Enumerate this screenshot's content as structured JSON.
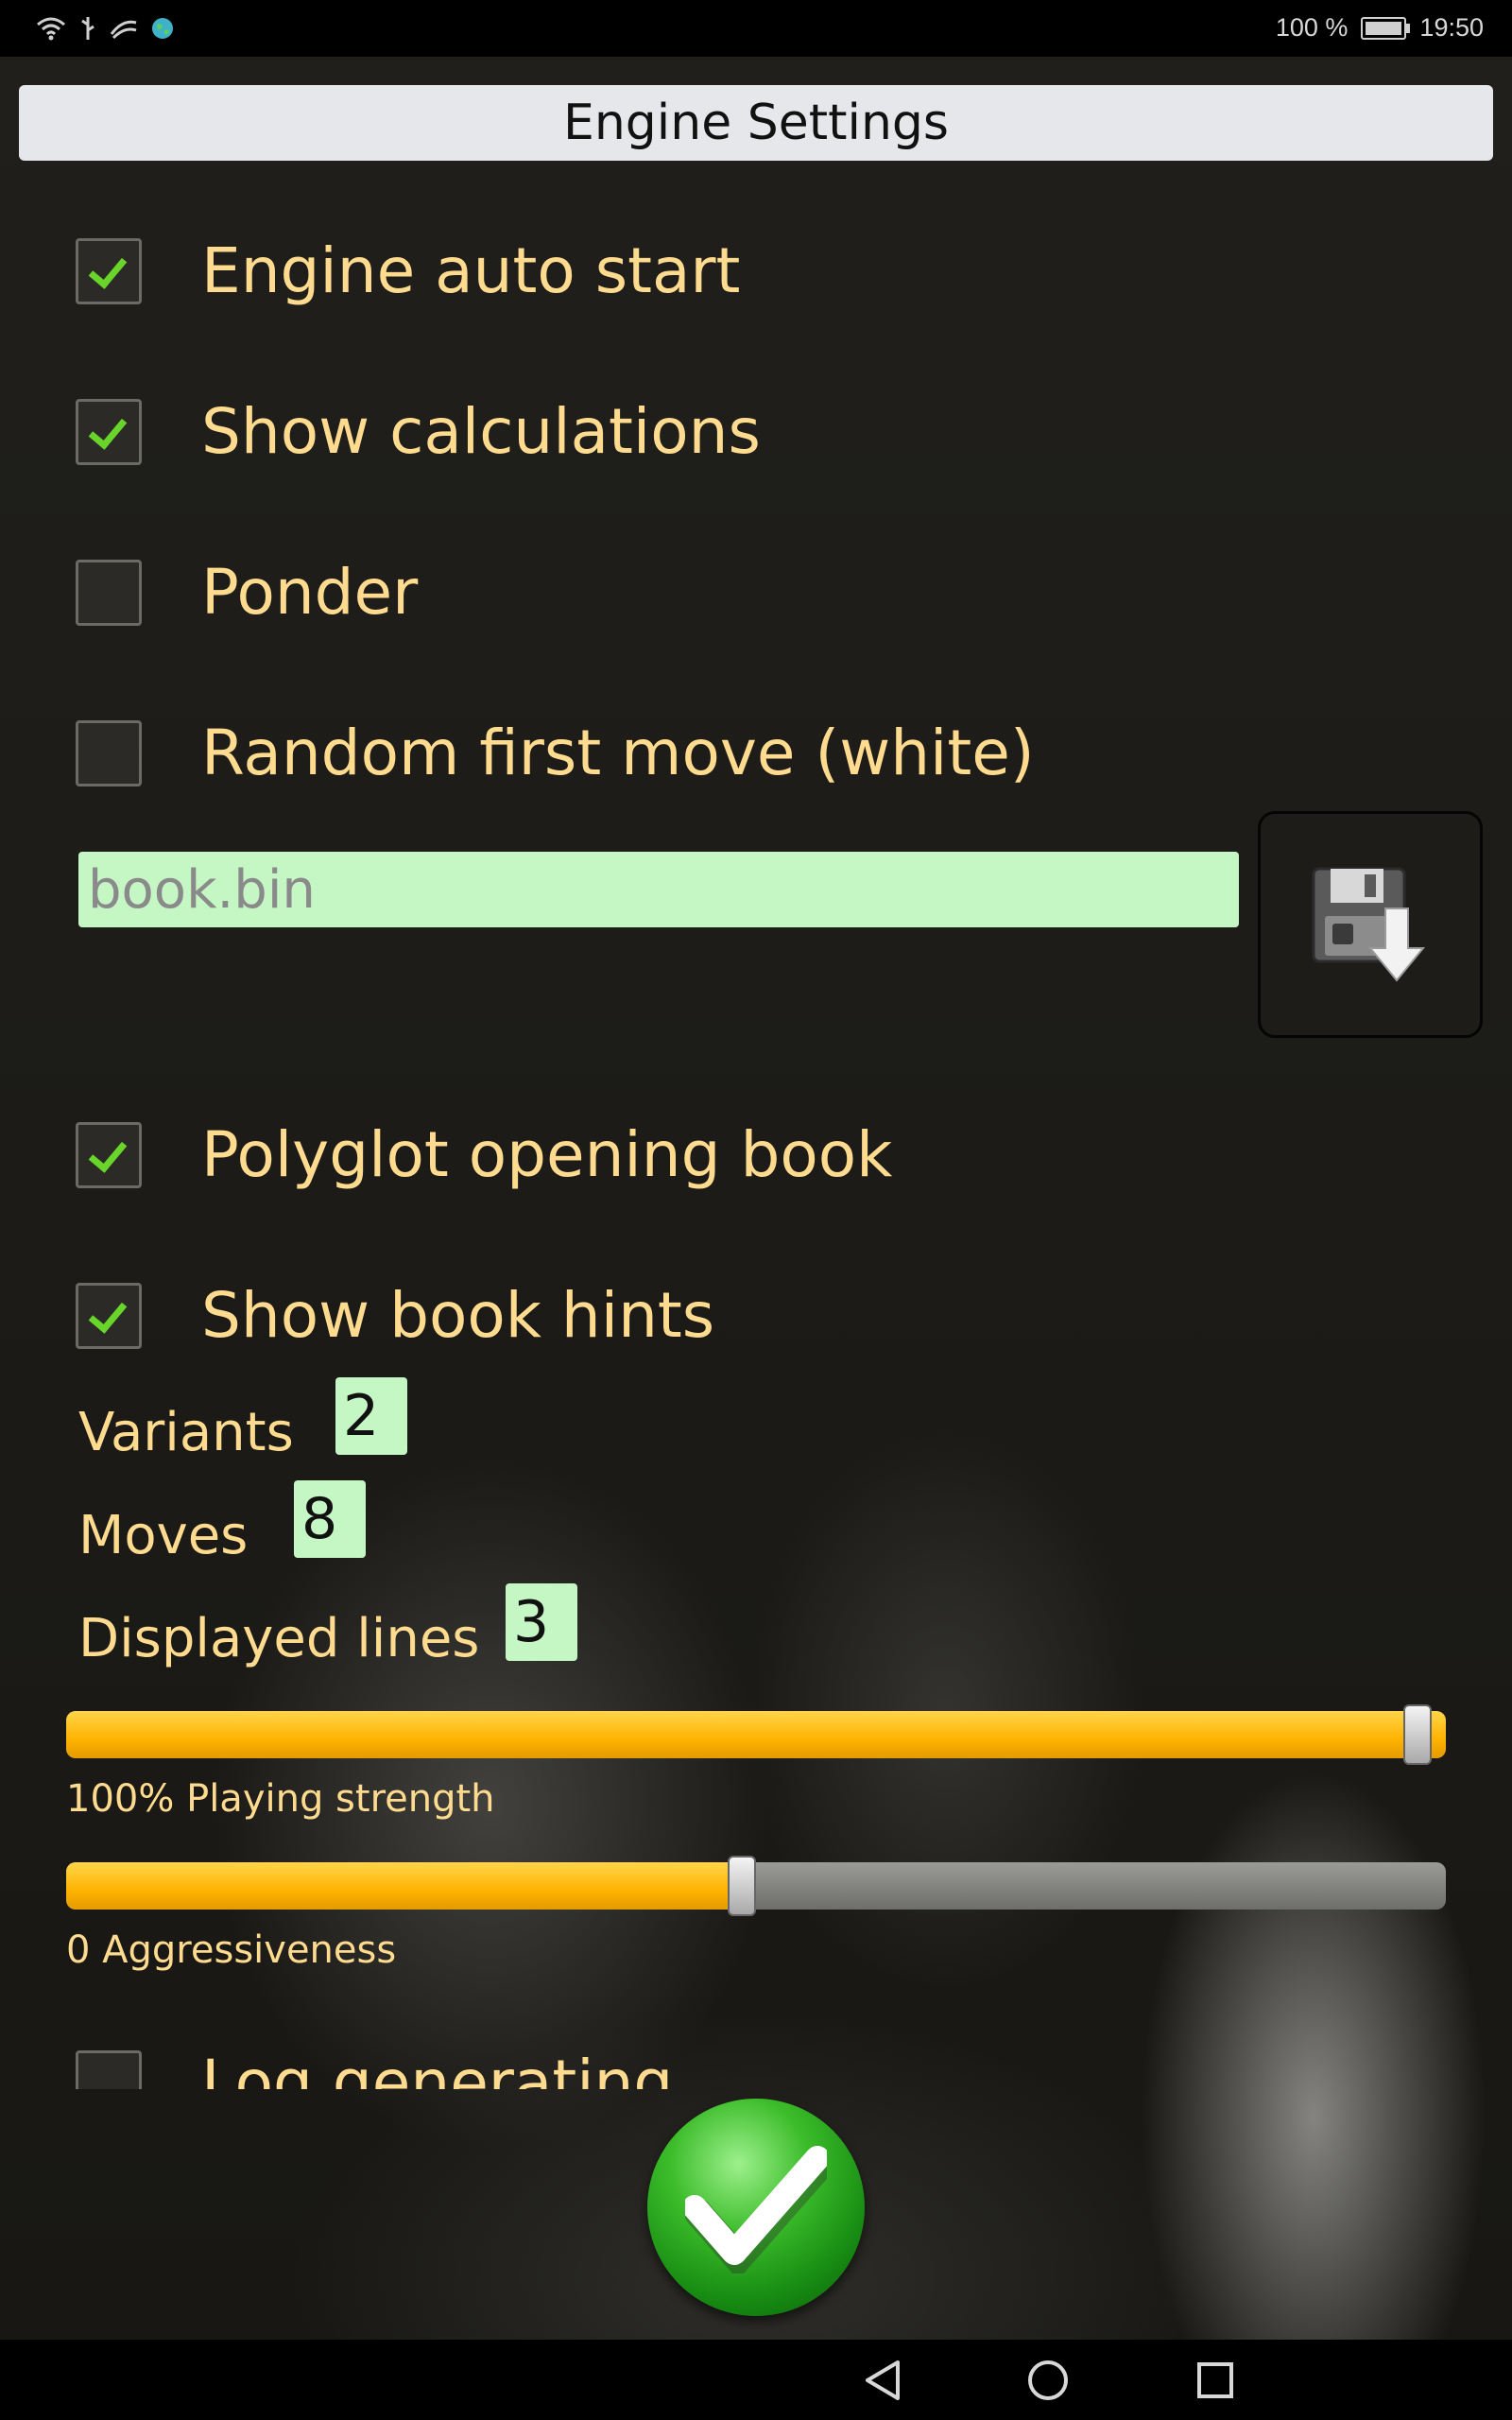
{
  "status_bar": {
    "battery": "100 %",
    "time": "19:50",
    "icons": [
      "wifi-icon",
      "usb-icon",
      "signal-icon",
      "globe-icon",
      "battery-icon"
    ]
  },
  "title": "Engine Settings",
  "options": [
    {
      "label": "Engine auto start",
      "checked": true
    },
    {
      "label": "Show calculations",
      "checked": true
    },
    {
      "label": "Ponder",
      "checked": false
    },
    {
      "label": "Random first move (white)",
      "checked": false
    }
  ],
  "book": {
    "file_placeholder": "book.bin",
    "save_icon": "floppy-download-icon"
  },
  "book_options": [
    {
      "label": "Polyglot opening book",
      "checked": true
    },
    {
      "label": "Show book hints",
      "checked": true
    }
  ],
  "numbers": [
    {
      "label": "Variants",
      "value": "2"
    },
    {
      "label": "Moves",
      "value": "8"
    },
    {
      "label": "Displayed lines",
      "value": "3"
    }
  ],
  "sliders": [
    {
      "label": "100% Playing strength",
      "value_fraction": 1.0
    },
    {
      "label": "0 Aggressiveness",
      "value_fraction": 0.5
    }
  ],
  "log_option": {
    "label": "Log generating",
    "checked": false
  },
  "ok_icon": "checkmark-icon",
  "nav": [
    "back-icon",
    "home-icon",
    "recents-icon"
  ],
  "colors": {
    "label": "#fedb8f",
    "input_bg": "#c5f7c5",
    "slider": "#ffb300",
    "check": "#69d42a"
  }
}
